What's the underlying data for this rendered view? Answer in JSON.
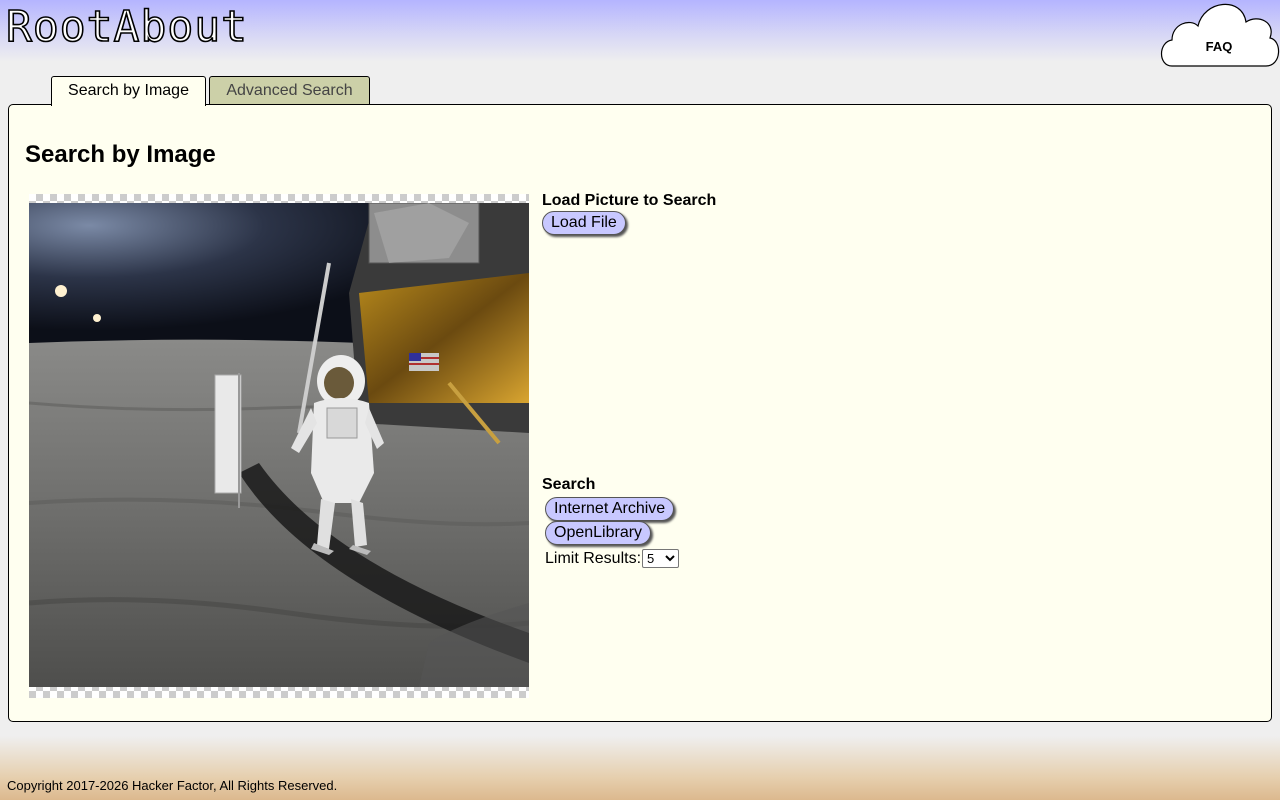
{
  "header": {
    "logo_text": "RootAbout",
    "faq_label": "FAQ"
  },
  "tabs": [
    {
      "label": "Search by Image",
      "active": true
    },
    {
      "label": "Advanced Search",
      "active": false
    }
  ],
  "panel": {
    "title": "Search by Image",
    "image_subject": "astronaut-on-moon-photo",
    "load_section": {
      "heading": "Load Picture to Search",
      "load_button": "Load File"
    },
    "search_section": {
      "heading": "Search",
      "buttons": [
        "Internet Archive",
        "OpenLibrary"
      ],
      "limit_label": "Limit Results:",
      "limit_value": "5"
    }
  },
  "footer": {
    "copyright": "Copyright 2017-2026 Hacker Factor, All Rights Reserved."
  },
  "colors": {
    "panel_bg": "#fffff0",
    "button_bg": "#c8c8ff",
    "inactive_tab_bg": "#ccd0a8",
    "header_gradient_top": "#b4b4ff",
    "footer_gradient_bottom": "#dcb98e"
  }
}
